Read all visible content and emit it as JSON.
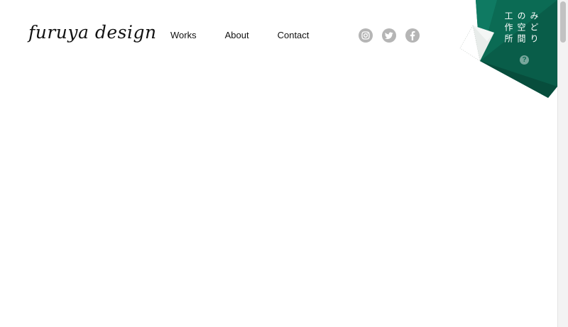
{
  "header": {
    "logo_text": "furuya design",
    "nav": [
      {
        "label": "Works"
      },
      {
        "label": "About"
      },
      {
        "label": "Contact"
      }
    ],
    "social": [
      {
        "icon": "instagram-icon"
      },
      {
        "icon": "twitter-icon"
      },
      {
        "icon": "facebook-icon"
      }
    ]
  },
  "badge": {
    "line1": "みどり",
    "line2": "の空間",
    "line3": "工作所",
    "help_glyph": "?",
    "colors": {
      "green": "#0b6b54",
      "green_dark": "#074d3c",
      "green_light": "#12806a"
    }
  },
  "colors": {
    "text": "#111111",
    "social_icon_bg": "#b5b5b5",
    "background": "#ffffff"
  }
}
